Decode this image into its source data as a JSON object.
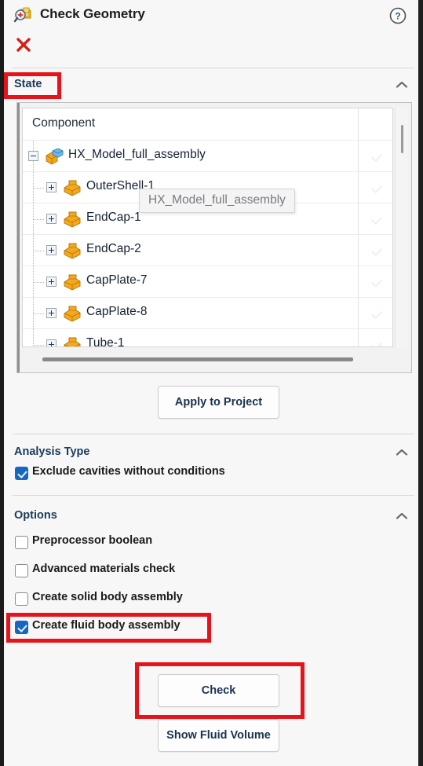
{
  "window": {
    "title": "Check Geometry",
    "title_icon": "check-geometry-icon",
    "help_icon": "help-circle-icon",
    "close_icon": "close-x-icon"
  },
  "sections": {
    "state": {
      "label": "State",
      "collapse_icon": "chevron-up-icon"
    },
    "analysis_type": {
      "label": "Analysis Type",
      "collapse_icon": "chevron-up-icon"
    },
    "options": {
      "label": "Options",
      "collapse_icon": "chevron-up-icon"
    }
  },
  "tree": {
    "column_header": "Component",
    "rows": [
      {
        "label": "HX_Model_full_assembly",
        "depth": 0,
        "expander": "minus",
        "checked": true,
        "icon": "assembly-icon"
      },
      {
        "label": "OuterShell-1",
        "depth": 1,
        "expander": "plus",
        "checked": true,
        "icon": "part-icon"
      },
      {
        "label": "EndCap-1",
        "depth": 1,
        "expander": "plus",
        "checked": true,
        "icon": "part-icon"
      },
      {
        "label": "EndCap-2",
        "depth": 1,
        "expander": "plus",
        "checked": true,
        "icon": "part-icon"
      },
      {
        "label": "CapPlate-7",
        "depth": 1,
        "expander": "plus",
        "checked": true,
        "icon": "part-icon"
      },
      {
        "label": "CapPlate-8",
        "depth": 1,
        "expander": "plus",
        "checked": true,
        "icon": "part-icon"
      },
      {
        "label": "Tube-1",
        "depth": 1,
        "expander": "plus",
        "checked": true,
        "icon": "part-icon"
      }
    ],
    "tooltip": "HX_Model_full_assembly"
  },
  "buttons": {
    "apply_to_project": "Apply to Project",
    "check": "Check",
    "show_fluid_volume": "Show Fluid Volume"
  },
  "analysis_type_options": [
    {
      "label": "Exclude cavities without conditions",
      "checked": true
    }
  ],
  "options": [
    {
      "label": "Preprocessor boolean",
      "checked": false
    },
    {
      "label": "Advanced materials check",
      "checked": false
    },
    {
      "label": "Create solid body assembly",
      "checked": false
    },
    {
      "label": "Create fluid body assembly",
      "checked": true
    }
  ],
  "colors": {
    "accent_blue": "#1567c2",
    "section_label": "#1b3a5c",
    "annotation_red": "#e8131a",
    "close_red": "#d32116"
  }
}
